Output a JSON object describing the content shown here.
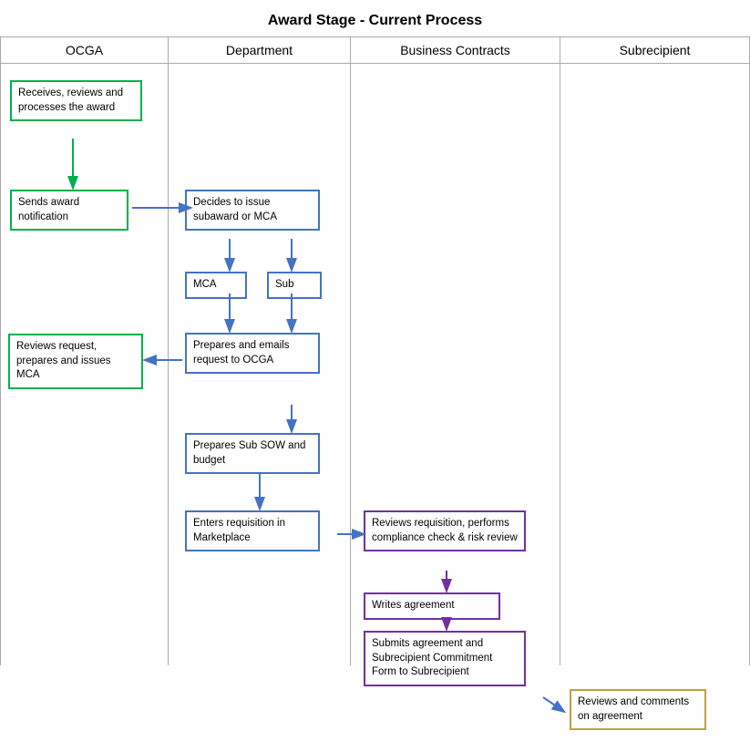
{
  "title": "Award Stage - Current Process",
  "lanes": [
    {
      "id": "ocga",
      "label": "OCGA"
    },
    {
      "id": "dept",
      "label": "Department"
    },
    {
      "id": "biz",
      "label": "Business Contracts"
    },
    {
      "id": "sub",
      "label": "Subrecipient"
    }
  ],
  "boxes": {
    "receives": "Receives, reviews and processes the award",
    "sends": "Sends award notification",
    "decides": "Decides to issue subaward or MCA",
    "mca": "MCA",
    "sub": "Sub",
    "prepares_emails": "Prepares and emails request to OCGA",
    "reviews_request": "Reviews request, prepares and issues MCA",
    "prepares_sub": "Prepares Sub SOW and budget",
    "enters_req": "Enters requisition in Marketplace",
    "reviews_req": "Reviews requisition, performs compliance check & risk review",
    "writes_agreement": "Writes agreement",
    "submits_agreement": "Submits agreement and Subrecipient Commitment Form to Subrecipient",
    "reviews_comments": "Reviews and comments on agreement"
  }
}
